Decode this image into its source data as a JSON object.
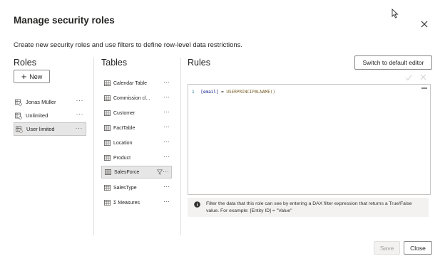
{
  "dialog": {
    "title": "Manage security roles",
    "subtitle": "Create new security roles and use filters to define row-level data restrictions."
  },
  "roles": {
    "heading": "Roles",
    "new_label": "New",
    "items": [
      {
        "label": "Jonas Müller",
        "selected": false
      },
      {
        "label": "Unlimited",
        "selected": false
      },
      {
        "label": "User limited",
        "selected": true
      }
    ],
    "more_label": "···"
  },
  "tables": {
    "heading": "Tables",
    "items": [
      {
        "label": "Calendar Table",
        "selected": false
      },
      {
        "label": "Commission cl...",
        "selected": false
      },
      {
        "label": "Customer",
        "selected": false
      },
      {
        "label": "FactTable",
        "selected": false
      },
      {
        "label": "Location",
        "selected": false
      },
      {
        "label": "Product",
        "selected": false
      },
      {
        "label": "SalesForce",
        "selected": true,
        "filtered": true
      },
      {
        "label": "SalesType",
        "selected": false
      },
      {
        "label": "Σ Measures",
        "selected": false
      }
    ],
    "more_label": "···"
  },
  "rules": {
    "heading": "Rules",
    "switch_label": "Switch to default editor",
    "code": {
      "line_number": "1",
      "column": "[email]",
      "operator": "=",
      "function": "USERPRINCIPALNAME()"
    },
    "info_text": "Filter the data that this role can see by entering a DAX filter expression that returns a True/False value. For example: [Entity ID] = \"Value\""
  },
  "footer": {
    "save_label": "Save",
    "close_label": "Close"
  },
  "colors": {
    "selected_bg": "#e6e6e6",
    "border": "#8a8886",
    "disabled_text": "#a19f9d"
  }
}
